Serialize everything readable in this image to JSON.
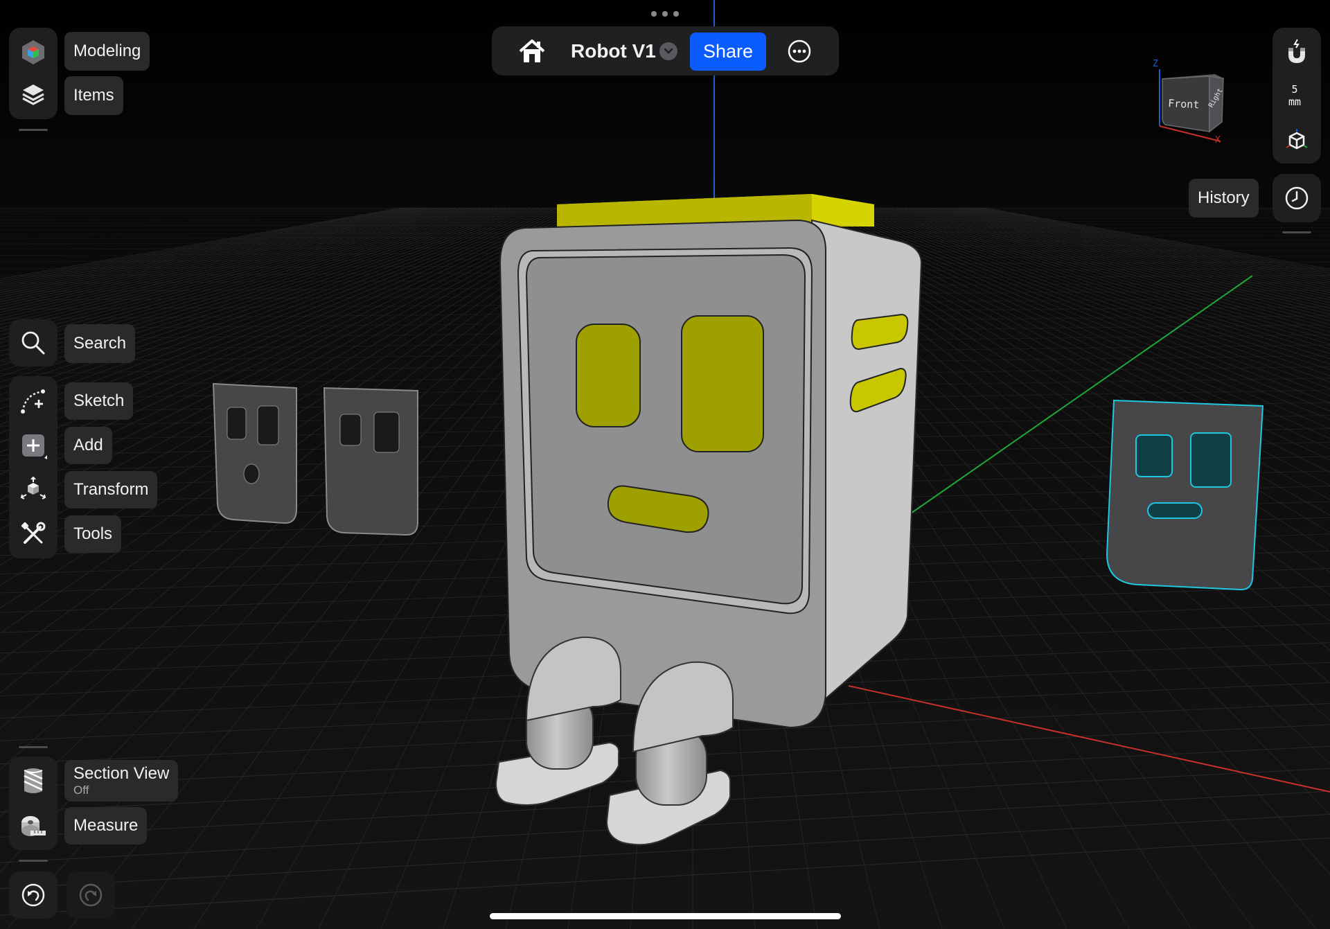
{
  "app": {
    "title": "Robot V1",
    "share_label": "Share"
  },
  "left_toolbar": {
    "top": [
      {
        "label": "Modeling",
        "icon": "modeling-cube-icon"
      },
      {
        "label": "Items",
        "icon": "layers-icon"
      }
    ],
    "tools": [
      {
        "label": "Search",
        "icon": "search-icon"
      },
      {
        "label": "Sketch",
        "icon": "sketch-icon"
      },
      {
        "label": "Add",
        "icon": "add-icon"
      },
      {
        "label": "Transform",
        "icon": "transform-icon"
      },
      {
        "label": "Tools",
        "icon": "tools-icon"
      }
    ],
    "bottom": [
      {
        "label": "Section View",
        "sublabel": "Off",
        "icon": "section-view-icon"
      },
      {
        "label": "Measure",
        "icon": "tape-measure-icon"
      }
    ],
    "undo_icon": "undo-icon",
    "redo_icon": "redo-icon"
  },
  "right_toolbar": {
    "snap_icon": "magnet-icon",
    "grid_value": "5",
    "grid_unit": "mm",
    "view_icon": "view-cube-icon",
    "history_label": "History",
    "history_icon": "clock-icon"
  },
  "view_cube": {
    "front_label": "Front",
    "right_label": "Right",
    "z_label": "Z",
    "x_label": "X"
  },
  "colors": {
    "accent": "#0b5cff",
    "selection_yellow": "#c9c700",
    "selection_cyan": "#1ec8e0",
    "axis_x": "#c8302a",
    "axis_y": "#1fa83a",
    "axis_z": "#1d5fd0",
    "background": "#0b0b0b"
  }
}
